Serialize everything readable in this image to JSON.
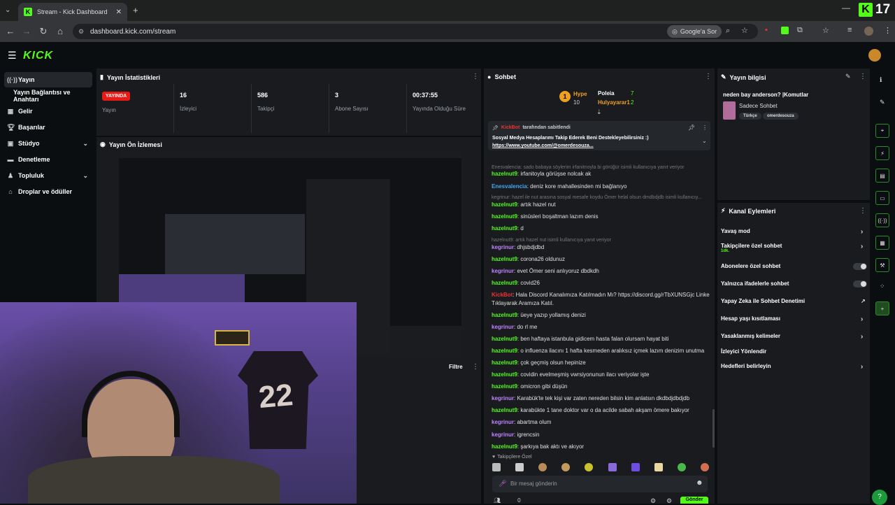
{
  "browser": {
    "tab_title": "Stream - Kick Dashboard",
    "new_tab_symbol": "+",
    "url": "dashboard.kick.com/stream",
    "google_button": "Google'a Sor",
    "kick_ext_count": "17"
  },
  "header": {
    "logo": "KICK"
  },
  "sidebar": {
    "items": [
      {
        "label": "Yayın",
        "icon": "broadcast-icon"
      },
      {
        "label": "Yayın Bağlantısı ve Anahtarı",
        "icon": ""
      },
      {
        "label": "Gelir",
        "icon": "revenue-icon"
      },
      {
        "label": "Başarılar",
        "icon": "trophy-icon"
      },
      {
        "label": "Stüdyo",
        "icon": "studio-icon"
      },
      {
        "label": "Denetleme",
        "icon": "moderation-icon"
      },
      {
        "label": "Topluluk",
        "icon": "community-icon"
      },
      {
        "label": "Droplar ve ödüller",
        "icon": "gift-icon"
      }
    ]
  },
  "stats": {
    "title": "Yayın İstatistikleri",
    "live_badge": "YAYINDA",
    "live_label": "Yayın",
    "viewers_value": "16",
    "viewers_label": "İzleyici",
    "followers_value": "586",
    "followers_label": "Takipçi",
    "subs_value": "3",
    "subs_label": "Abone Sayısı",
    "uptime_value": "00:37:55",
    "uptime_label": "Yayında Olduğu Süre"
  },
  "preview": {
    "title": "Yayın Ön İzlemesi",
    "filter_label": "Filtre",
    "jersey_number": "22"
  },
  "chat": {
    "title": "Sohbet",
    "hype_label": "Hype",
    "hype_value": "10",
    "leader1": "Poleia",
    "leader1_count": "7",
    "leader2": "Hulyayarar1",
    "leader2_count": "2",
    "pinned_by_user": "KickBot",
    "pinned_by_suffix": "tarafından sabitlendi",
    "pinned_text": "Sosyal Medya Hesaplarımı Takip Ederek Beni Destekleyebilirsiniz :)",
    "pinned_link": "https://www.youtube.com/@omerdesouza...",
    "messages": [
      {
        "type": "reply",
        "text": "Enesvalencia: sado babaya söylerim irfanitnoyla bi görüğür isimli kullanıcıya yanıt veriyor"
      },
      {
        "type": "msg",
        "user": "hazelnut9",
        "text": ": irfanitoyla görüşse nolcak ak"
      },
      {
        "type": "msg",
        "user": "Enesvalencia",
        "text": ": deniz kore mahallesinden mi bağlanıyo",
        "cls": "blue"
      },
      {
        "type": "reply",
        "text": "kegrinur: hazel ile nut arasına sosyal mesafe koydu Ömer helal olsun dmdbdjdb isimli kullanıcıy..."
      },
      {
        "type": "msg",
        "user": "hazelnut9",
        "text": ": artık hazel nut"
      },
      {
        "type": "msg",
        "user": "hazelnut9",
        "text": ": sinüsleri boşaltman lazım denis"
      },
      {
        "type": "msg",
        "user": "hazelnut9",
        "text": ": d"
      },
      {
        "type": "reply",
        "text": "hazelnut9: artık hazel nut isimli kullanıcıya yanıt veriyor"
      },
      {
        "type": "msg",
        "user": "kegrinur",
        "text": ": dhjsbdjdbd",
        "cls": "purple"
      },
      {
        "type": "msg",
        "user": "hazelnut9",
        "text": ": corona26 oldunuz"
      },
      {
        "type": "msg",
        "user": "kegrinur",
        "text": ": evet Ömer seni anlıyoruz dbdkdh",
        "cls": "purple"
      },
      {
        "type": "msg",
        "user": "hazelnut9",
        "text": ": covid26"
      },
      {
        "type": "msg",
        "user": "KickBot",
        "text": ": Hala Discord Kanalımıza Katılmadın Mı? https://discord.gg/rTbXUNSGjc Linke",
        "cls": "red"
      },
      {
        "type": "cont",
        "text": "Tıklayarak Aramıza Katıl."
      },
      {
        "type": "msg",
        "user": "hazelnut9",
        "text": ": üeye yazıp yollamış denizi"
      },
      {
        "type": "msg",
        "user": "kegrinur",
        "text": ": do rl me",
        "cls": "purple"
      },
      {
        "type": "msg",
        "user": "hazelnut9",
        "text": ": ben haftaya istanbula gidicem hasta falan olursam hayat biti"
      },
      {
        "type": "msg",
        "user": "hazelnut9",
        "text": ": o influenza ilacını 1 hafta kesmeden aralıksız içmek lazım denizim unutma"
      },
      {
        "type": "msg",
        "user": "hazelnut9",
        "text": ": çok geçmiş olsun hepinize"
      },
      {
        "type": "msg",
        "user": "hazelnut9",
        "text": ": covidin evelmeşmiş vwrsiyonunun ilacı veriyolar işte"
      },
      {
        "type": "msg",
        "user": "hazelnut9",
        "text": ": omicron gibi düşün"
      },
      {
        "type": "msg",
        "user": "kegrinur",
        "text": ": Karabük'te tek kişi var zaten nereden bilsin kim anlatsın dkdbdjdbdjdb",
        "cls": "purple"
      },
      {
        "type": "msg",
        "user": "hazelnut9",
        "text": ": karabükte 1 tane doktor var o da acilde sabah akşam ömere bakıyor"
      },
      {
        "type": "msg",
        "user": "kegrinur",
        "text": ": abartma olum",
        "cls": "purple"
      },
      {
        "type": "msg",
        "user": "kegrinur",
        "text": ": igrencsin",
        "cls": "purple"
      },
      {
        "type": "msg",
        "user": "hazelnut9",
        "text": ": şarkıya bak aktı ve akıyor"
      }
    ],
    "followers_only": "Takipçilere Özel",
    "input_placeholder": "Bir mesaj gönderin",
    "send_label": "Gönder",
    "bottom_count": "0"
  },
  "info": {
    "title": "Yayın bilgisi",
    "stream_title": "neden bay anderson? |Komutlar",
    "category": "Sadece Sohbet",
    "tags": [
      "Türkçe",
      "omerdesouza"
    ]
  },
  "actions": {
    "title": "Kanal Eylemleri",
    "items": [
      {
        "label": "Yavaş mod",
        "control": "chevron"
      },
      {
        "label": "Takipçilere özel sohbet",
        "sub": "1dk.",
        "control": "chevron"
      },
      {
        "label": "Abonelere özel sohbet",
        "control": "toggle"
      },
      {
        "label": "Yalnızca ifadelerle sohbet",
        "control": "toggle"
      },
      {
        "label": "Yapay Zeka ile Sohbet Denetimi",
        "control": "external"
      },
      {
        "label": "Hesap yaşı kısıtlaması",
        "control": "chevron"
      },
      {
        "label": "Yasaklanmış kelimeler",
        "control": "chevron"
      },
      {
        "label": "İzleyici Yönlendir",
        "control": "none"
      },
      {
        "label": "Hedefleri belirleyin",
        "control": "chevron"
      }
    ]
  },
  "colors": {
    "brand": "#53fc18",
    "live": "#e91916",
    "panel": "#191b1f",
    "bg": "#0b0e10"
  }
}
